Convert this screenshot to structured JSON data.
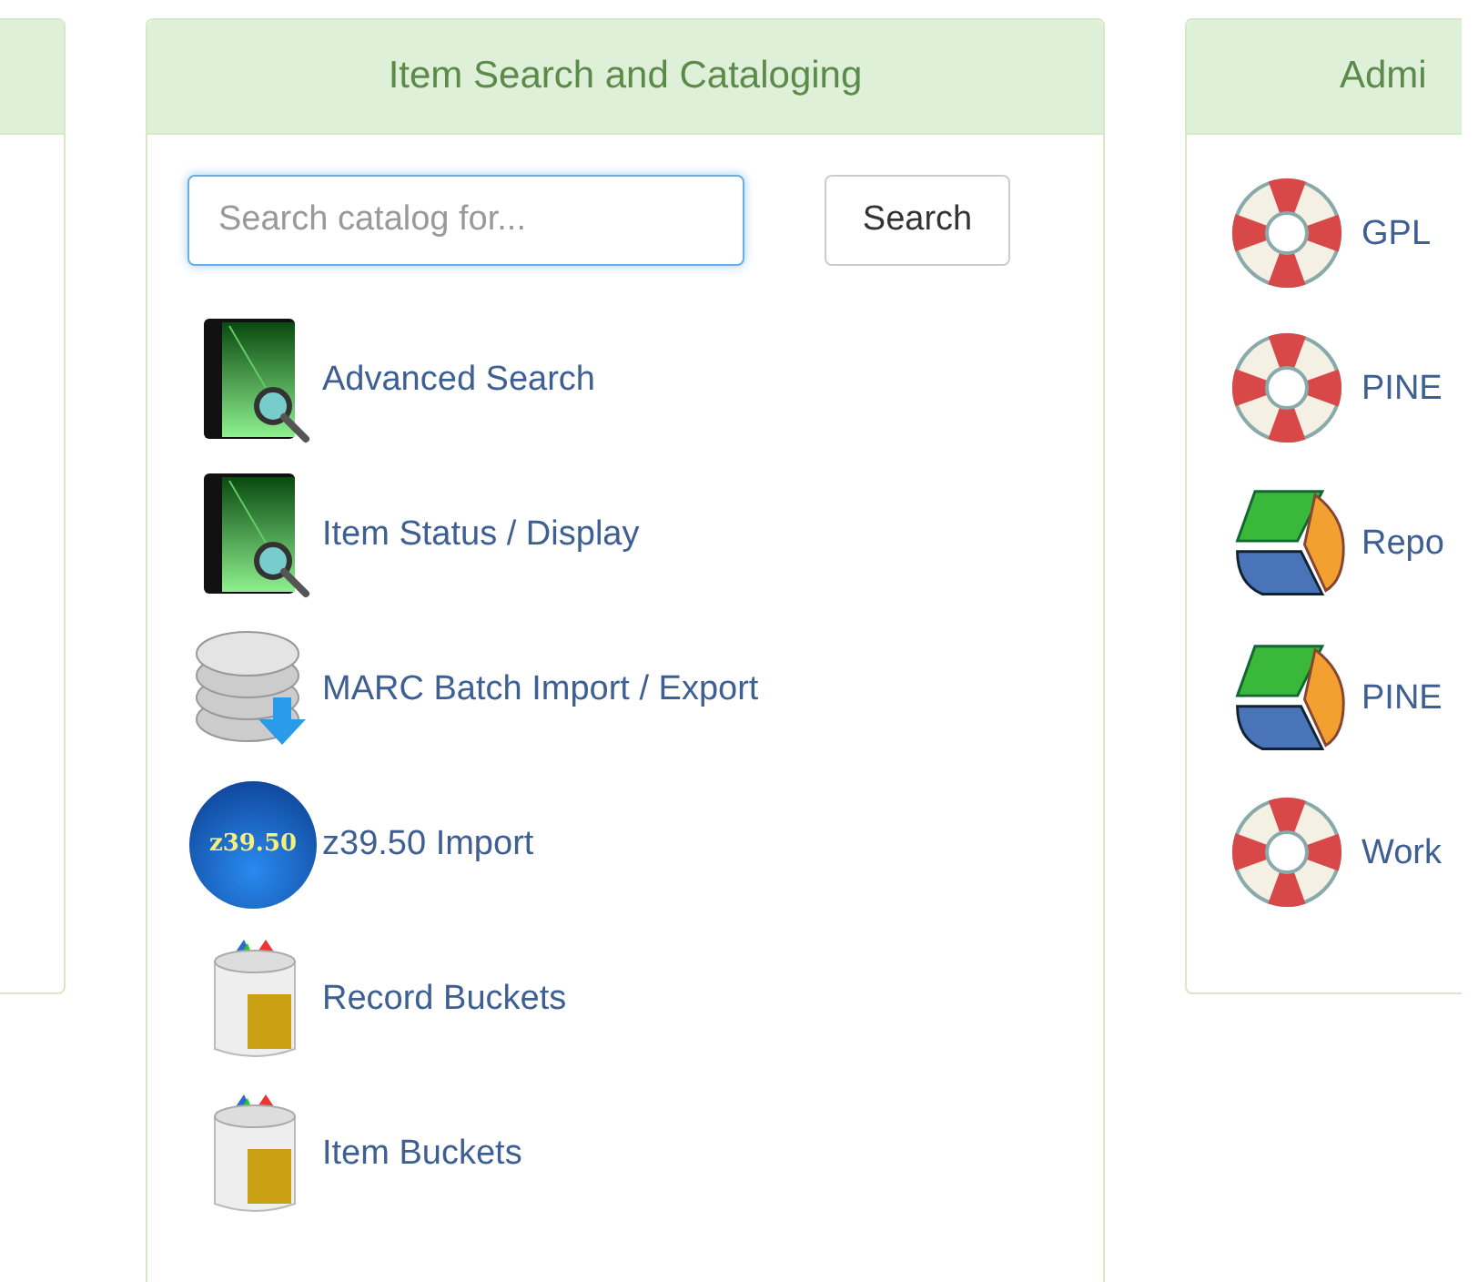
{
  "catalog_panel": {
    "title": "Item Search and Cataloging",
    "search": {
      "placeholder": "Search catalog for...",
      "focused": true
    },
    "search_button": "Search",
    "links": [
      {
        "kind": "book-search",
        "label": "Advanced Search"
      },
      {
        "kind": "book-search",
        "label": "Item Status / Display"
      },
      {
        "kind": "database-download",
        "label": "MARC Batch Import / Export"
      },
      {
        "kind": "badge",
        "badge": "z39.50",
        "label": "z39.50 Import"
      },
      {
        "kind": "bucket",
        "label": "Record Buckets"
      },
      {
        "kind": "bucket",
        "label": "Item Buckets"
      }
    ]
  },
  "admin_panel": {
    "title": "Admi",
    "links": [
      {
        "kind": "lifebuoy",
        "label": "GPL"
      },
      {
        "kind": "lifebuoy",
        "label": "PINE"
      },
      {
        "kind": "pie",
        "label": "Repo"
      },
      {
        "kind": "pie",
        "label": "PINE"
      },
      {
        "kind": "lifebuoy",
        "label": "Work"
      }
    ]
  }
}
